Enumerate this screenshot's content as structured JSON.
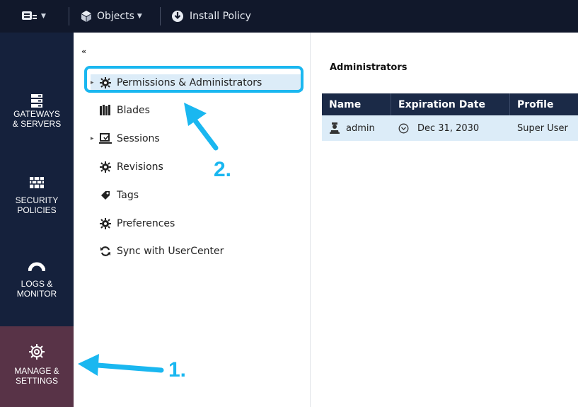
{
  "toolbar": {
    "objects_label": "Objects",
    "install_policy_label": "Install Policy"
  },
  "leftnav": {
    "items": [
      {
        "label": "GATEWAYS\n& SERVERS"
      },
      {
        "label": "SECURITY\nPOLICIES"
      },
      {
        "label": "LOGS &\nMONITOR"
      },
      {
        "label": "MANAGE &\nSETTINGS"
      }
    ]
  },
  "tree": {
    "collapse_glyph": "«",
    "items": [
      {
        "label": "Permissions & Administrators",
        "icon": "gear-icon"
      },
      {
        "label": "Blades",
        "icon": "blades-icon"
      },
      {
        "label": "Sessions",
        "icon": "sessions-icon"
      },
      {
        "label": "Revisions",
        "icon": "gear-icon"
      },
      {
        "label": "Tags",
        "icon": "tag-icon"
      },
      {
        "label": "Preferences",
        "icon": "gear-icon"
      },
      {
        "label": "Sync with UserCenter",
        "icon": "sync-icon"
      }
    ]
  },
  "content": {
    "title": "Administrators",
    "columns": [
      "Name",
      "Expiration Date",
      "Profile"
    ],
    "rows": [
      {
        "name": "admin",
        "expiration": "Dec 31, 2030",
        "profile": "Super User"
      }
    ]
  },
  "annotations": {
    "step1": "1.",
    "step2": "2."
  },
  "colors": {
    "topbar": "#11182b",
    "leftnav": "#15213c",
    "active_nav": "#583347",
    "table_header": "#1b2a47",
    "selected_row": "#dcecf8",
    "annotation": "#1ab7f0"
  }
}
